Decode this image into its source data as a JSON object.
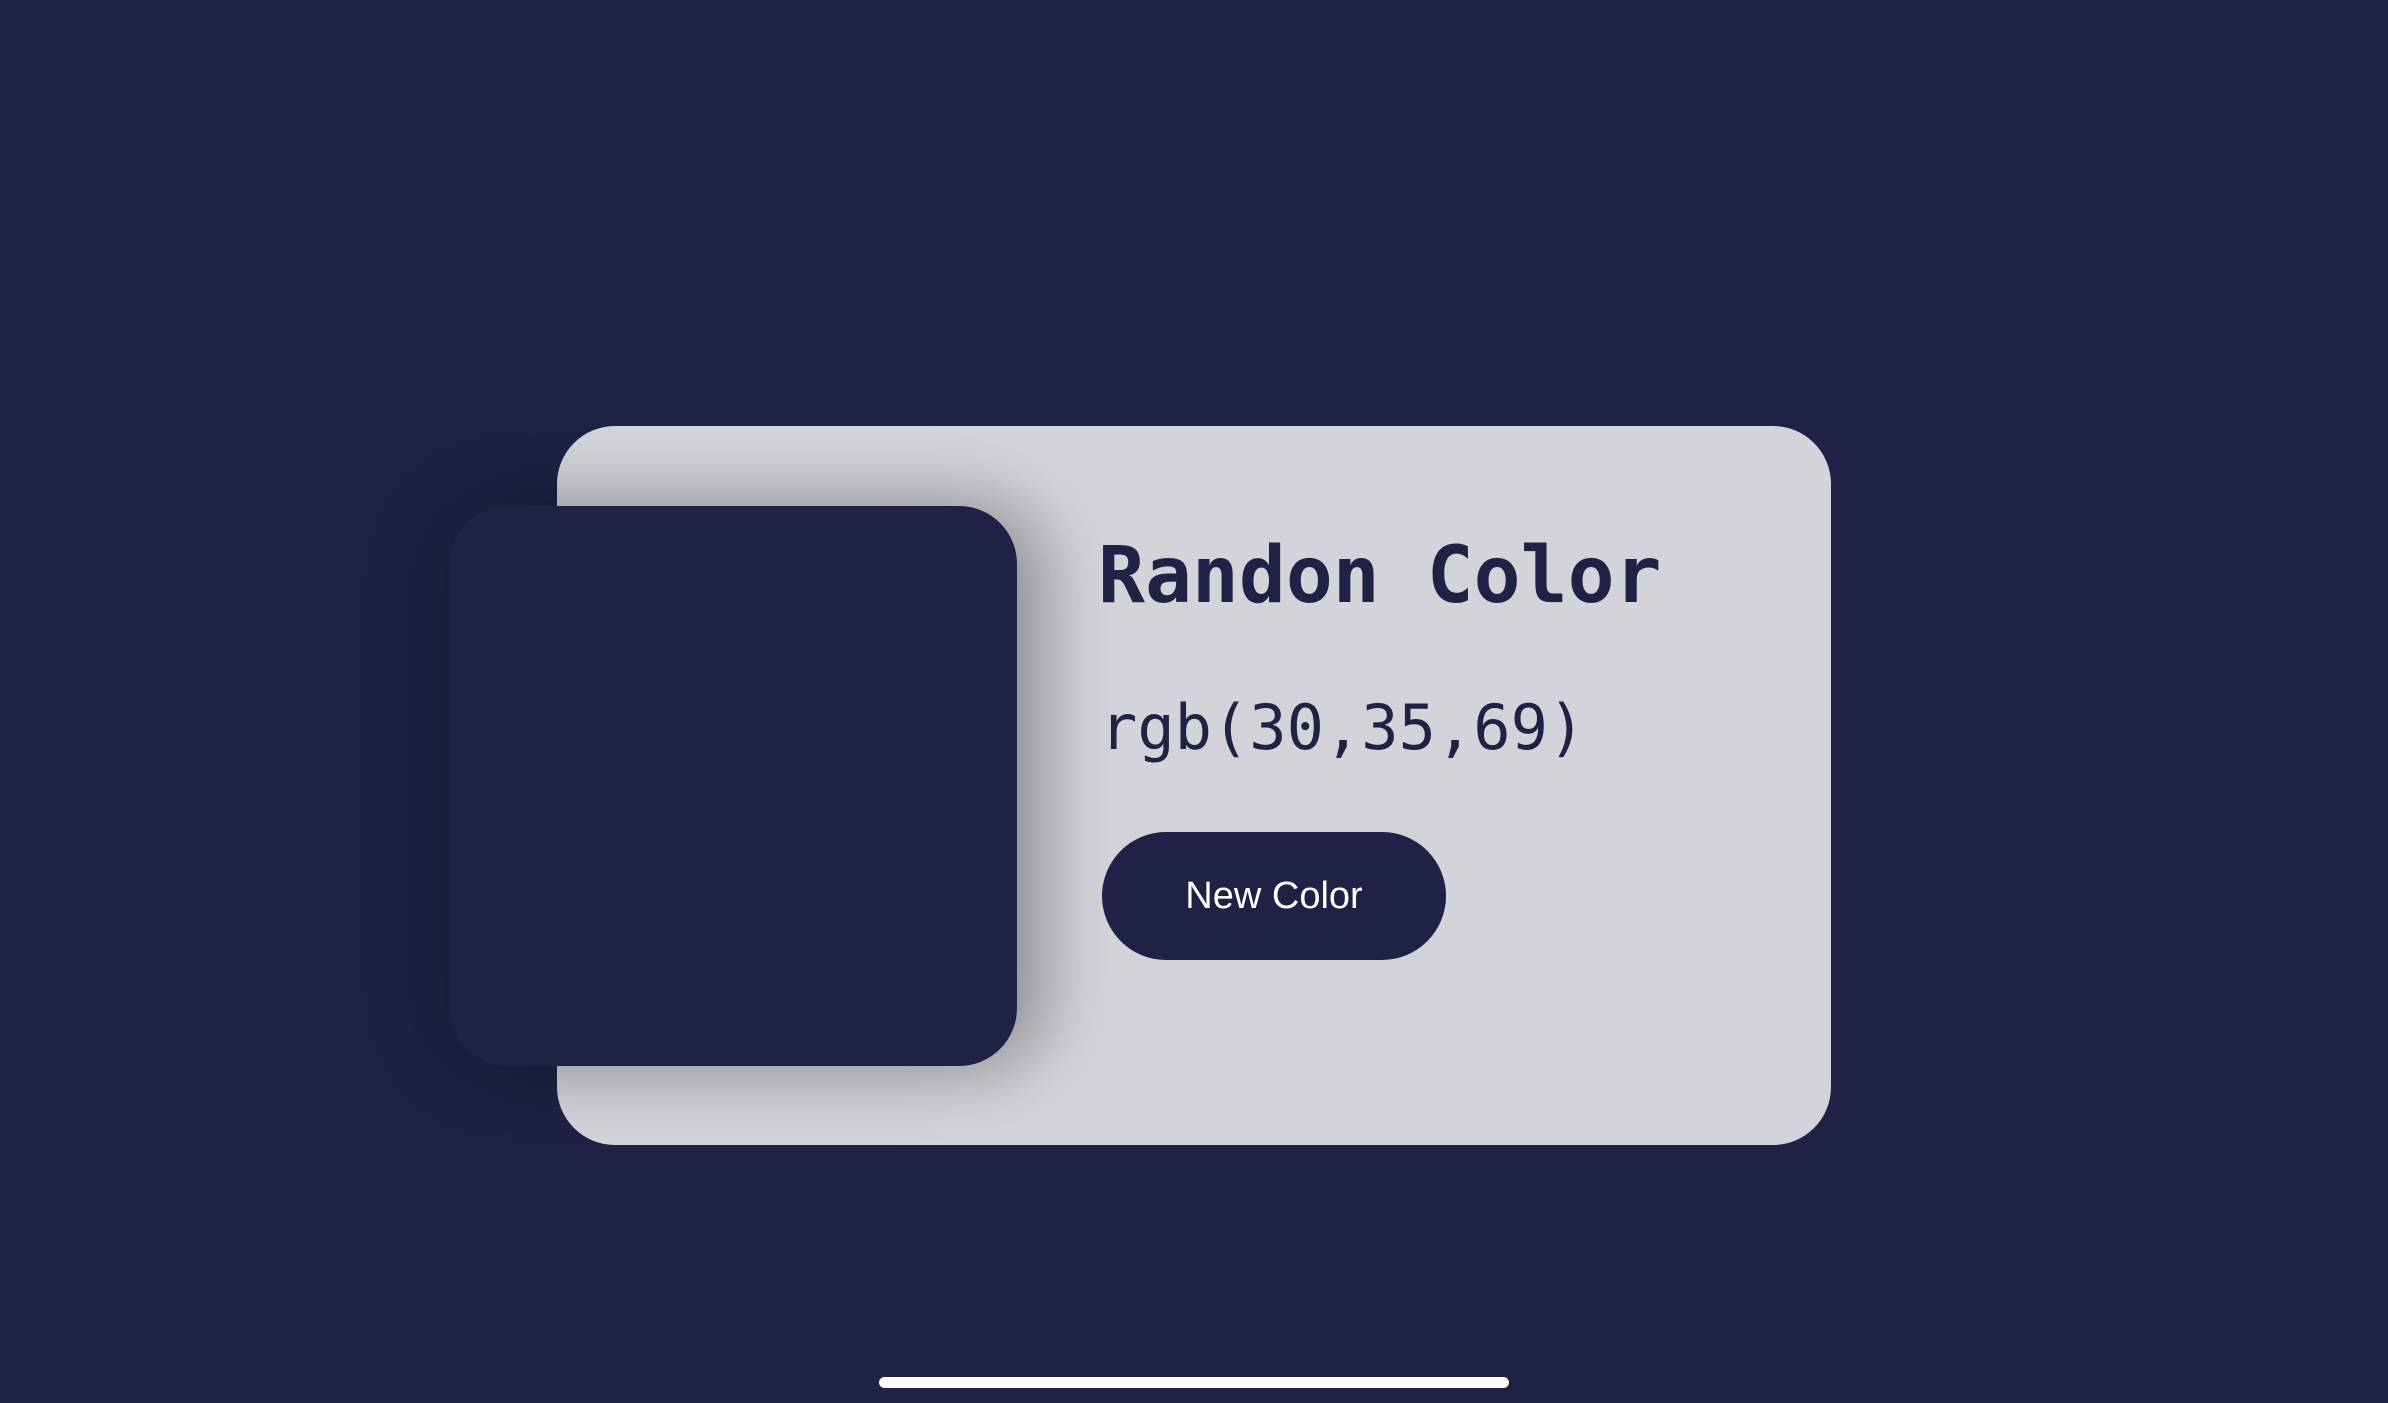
{
  "app": {
    "title": "Randon Color",
    "rgb_text": "rgb(30,35,69)",
    "current_color": {
      "r": 30,
      "g": 35,
      "b": 69,
      "hex": "#1e2345"
    }
  },
  "actions": {
    "new_color_label": "New Color"
  },
  "colors": {
    "background": "#1f2245",
    "card": "#d3d4d9",
    "text": "#1f2245",
    "button_text": "#ffffff"
  }
}
